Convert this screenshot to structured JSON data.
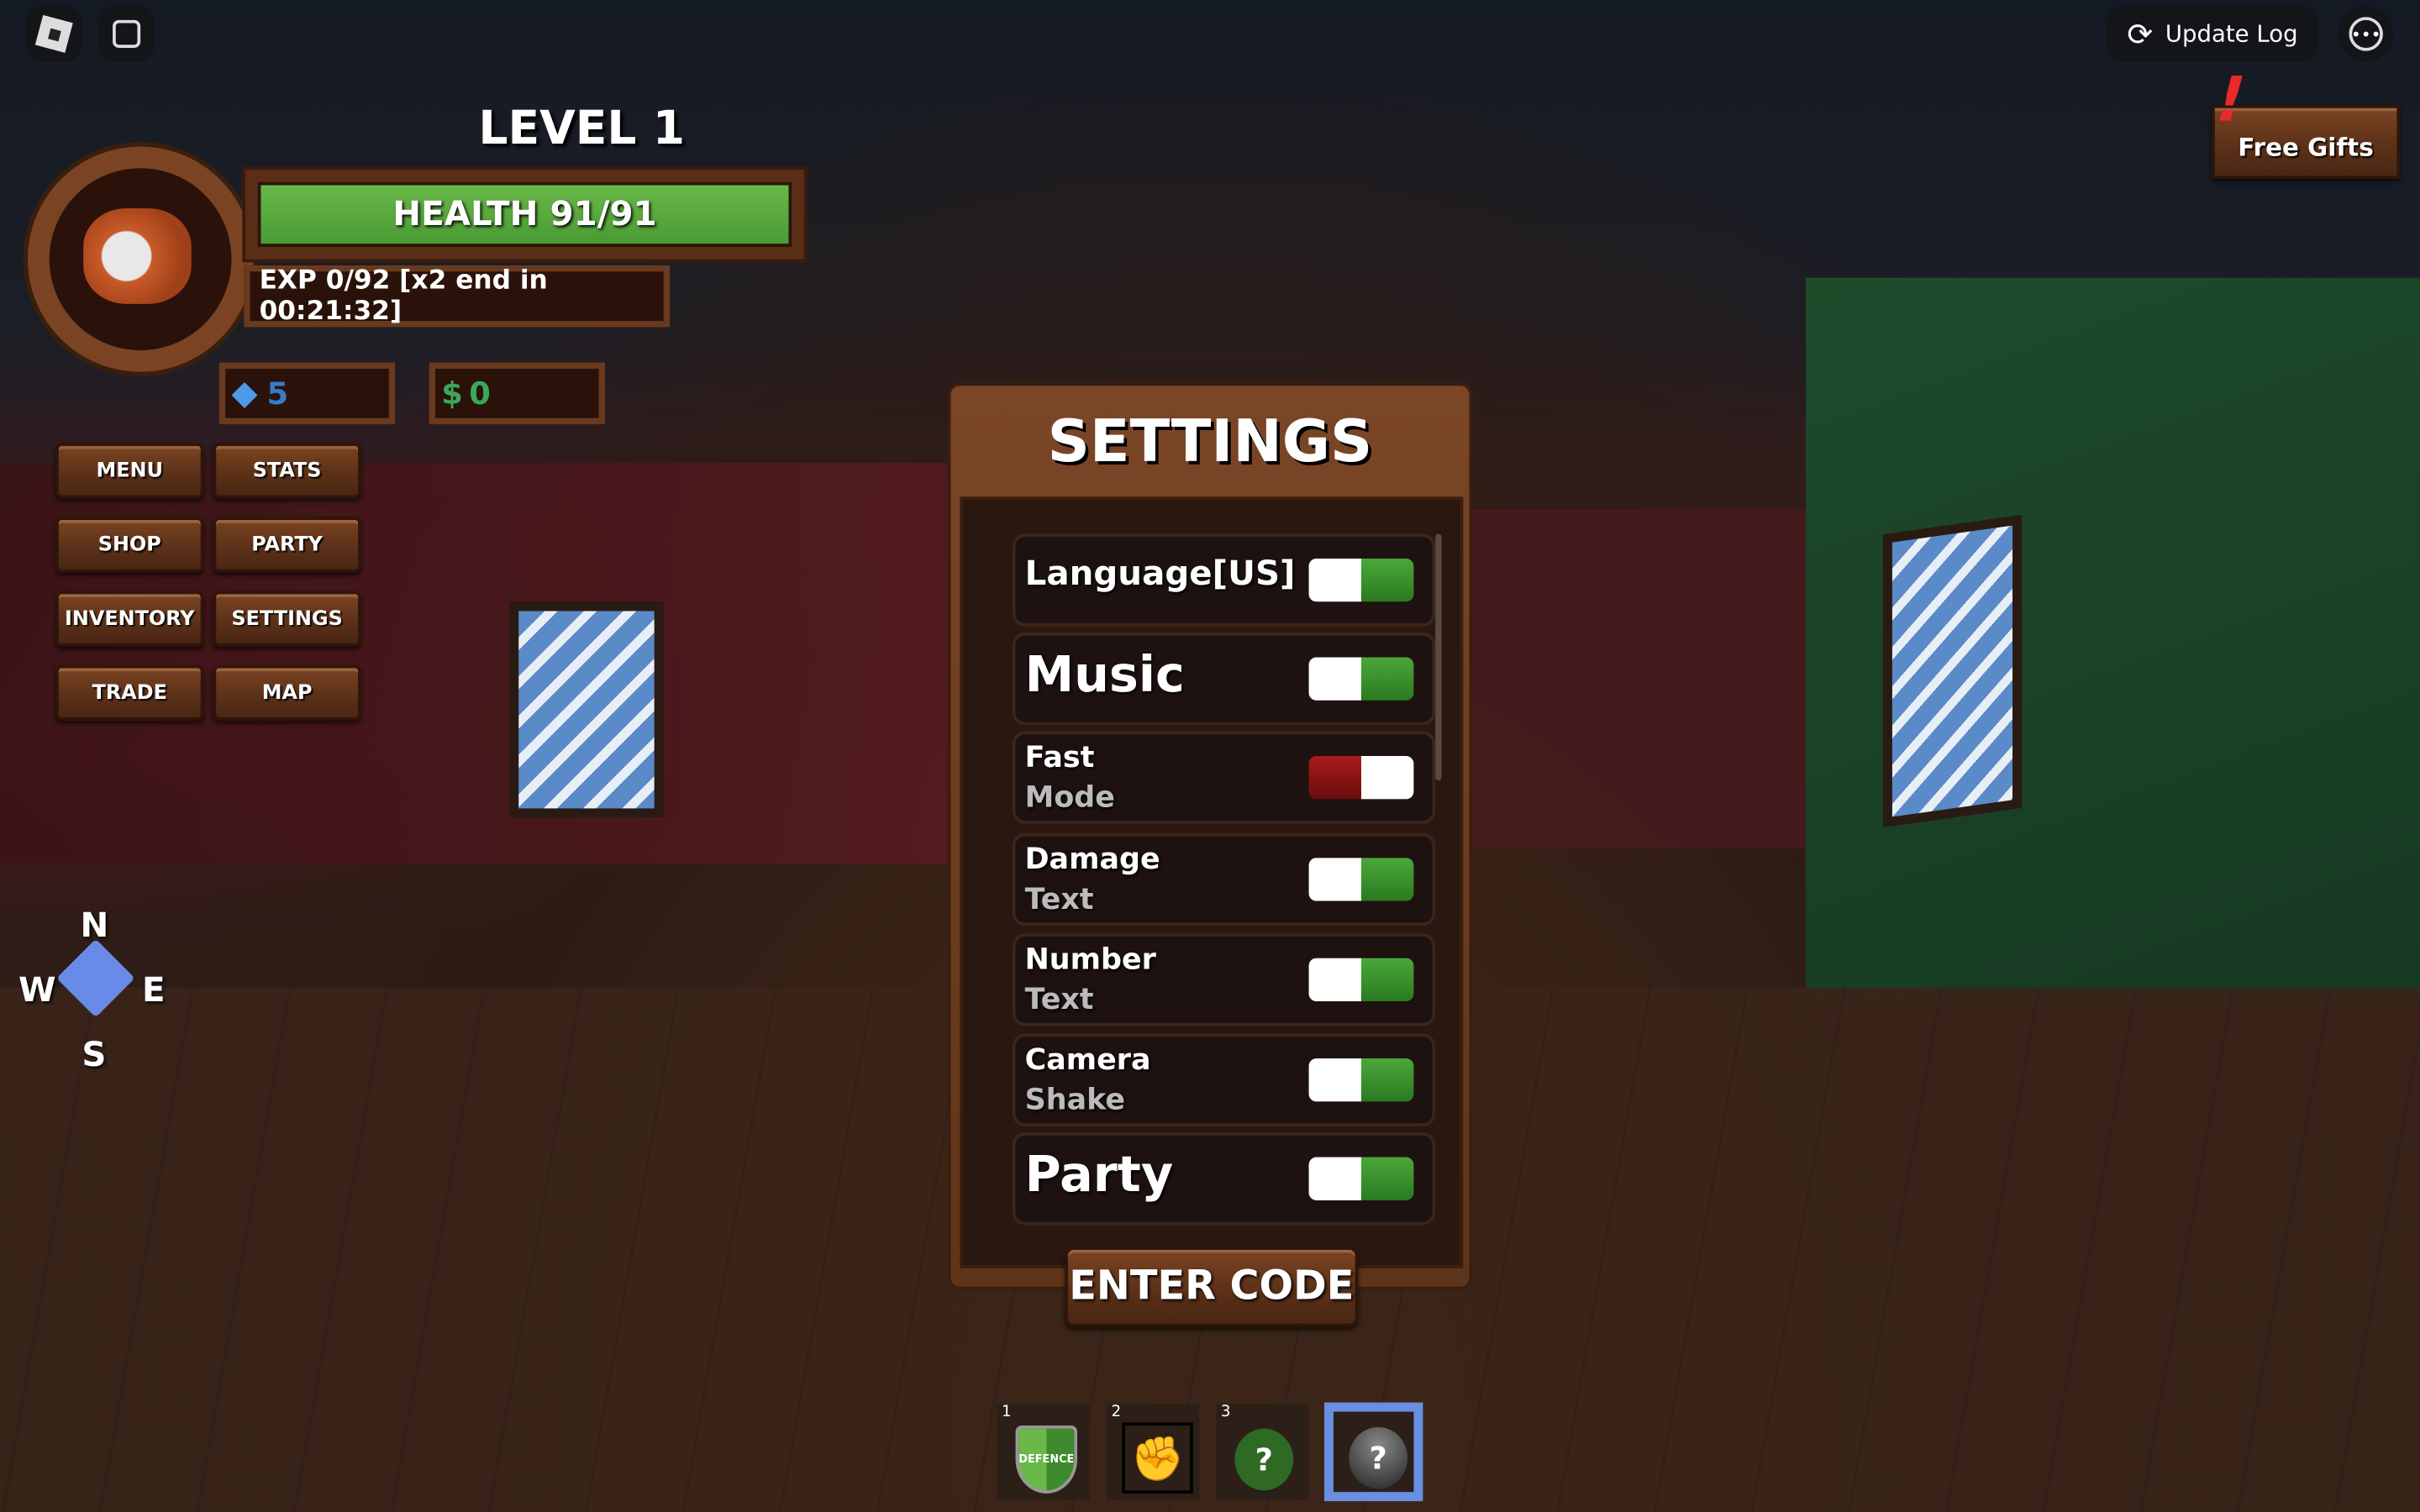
{
  "topbar": {
    "update_log": "Update Log",
    "more_icon": "ellipsis-icon"
  },
  "free_gifts": "Free Gifts",
  "alert_mark": "!",
  "player": {
    "level": "LEVEL 1",
    "health": "HEALTH 91/91",
    "health_fraction": 1.0,
    "exp": "EXP 0/92 [x2 end in 00:21:32]",
    "gems": "5",
    "money_symbol": "$",
    "money": "0"
  },
  "menu": [
    {
      "label": "MENU"
    },
    {
      "label": "STATS"
    },
    {
      "label": "SHOP"
    },
    {
      "label": "PARTY"
    },
    {
      "label": "INVENTORY"
    },
    {
      "label": "SETTINGS"
    },
    {
      "label": "TRADE"
    },
    {
      "label": "MAP"
    }
  ],
  "compass": {
    "n": "N",
    "s": "S",
    "e": "E",
    "w": "W"
  },
  "settings": {
    "title": "SETTINGS",
    "options": [
      {
        "line1": "Language[US]",
        "line2": "",
        "on": true
      },
      {
        "line1": "Music",
        "line2": "",
        "on": true
      },
      {
        "line1": "Fast",
        "line2": "Mode",
        "on": false
      },
      {
        "line1": "Damage",
        "line2": "Text",
        "on": true
      },
      {
        "line1": "Number",
        "line2": "Text",
        "on": true
      },
      {
        "line1": "Camera",
        "line2": "Shake",
        "on": true
      },
      {
        "line1": "Party",
        "line2": "",
        "on": true
      }
    ],
    "enter_code": "ENTER CODE"
  },
  "hotbar": [
    {
      "num": "1",
      "item": "DEFENCE"
    },
    {
      "num": "2",
      "item": "fist"
    },
    {
      "num": "3",
      "item": "?"
    },
    {
      "num": "",
      "item": "?",
      "selected": true
    }
  ],
  "colors": {
    "health": "#5cb040",
    "selected_slot": "#6a8ee0",
    "toggle_on": "#3a9a2c",
    "toggle_off": "#9a1616"
  }
}
